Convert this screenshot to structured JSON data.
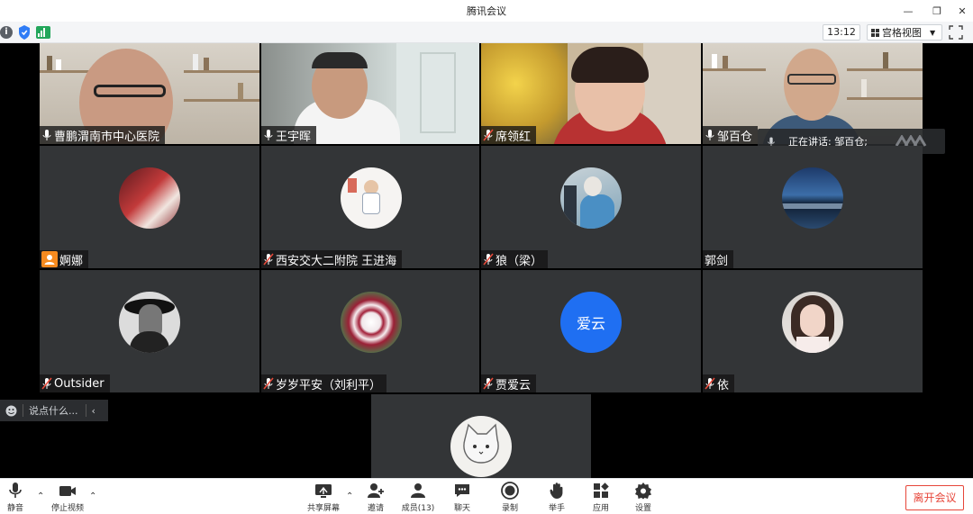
{
  "app": {
    "title": "腾讯会议"
  },
  "statusbar": {
    "time": "13:12",
    "view_mode": "宫格视图"
  },
  "participants": [
    {
      "name": "曹鹏渭南市中心医院"
    },
    {
      "name": "王宇晖"
    },
    {
      "name": "席领红"
    },
    {
      "name": "邹百仓"
    },
    {
      "name": "婀娜"
    },
    {
      "name": "西安交大二附院 王进海"
    },
    {
      "name": "狼（梁）"
    },
    {
      "name": "郭剑"
    },
    {
      "name": "Outsider"
    },
    {
      "name": "岁岁平安（刘利平）"
    },
    {
      "name": "贾爱云",
      "avatar_text": "爱云"
    },
    {
      "name": "依"
    }
  ],
  "speaking": {
    "text": "正在讲话: 邹百仓;"
  },
  "chat": {
    "placeholder": "说点什么..."
  },
  "toolbar": {
    "mute": "静音",
    "stop_video": "停止视频",
    "share_screen": "共享屏幕",
    "invite": "邀请",
    "members": "成员(13)",
    "chat": "聊天",
    "record": "录制",
    "raise_hand": "举手",
    "apps": "应用",
    "settings": "设置",
    "leave": "离开会议"
  },
  "colors": {
    "accent": "#1677ff",
    "avatar_blue": "#1f6ff2",
    "leave_red": "#e7463a",
    "tile_bg": "#333537",
    "mic_muted": "#e74a3b"
  }
}
